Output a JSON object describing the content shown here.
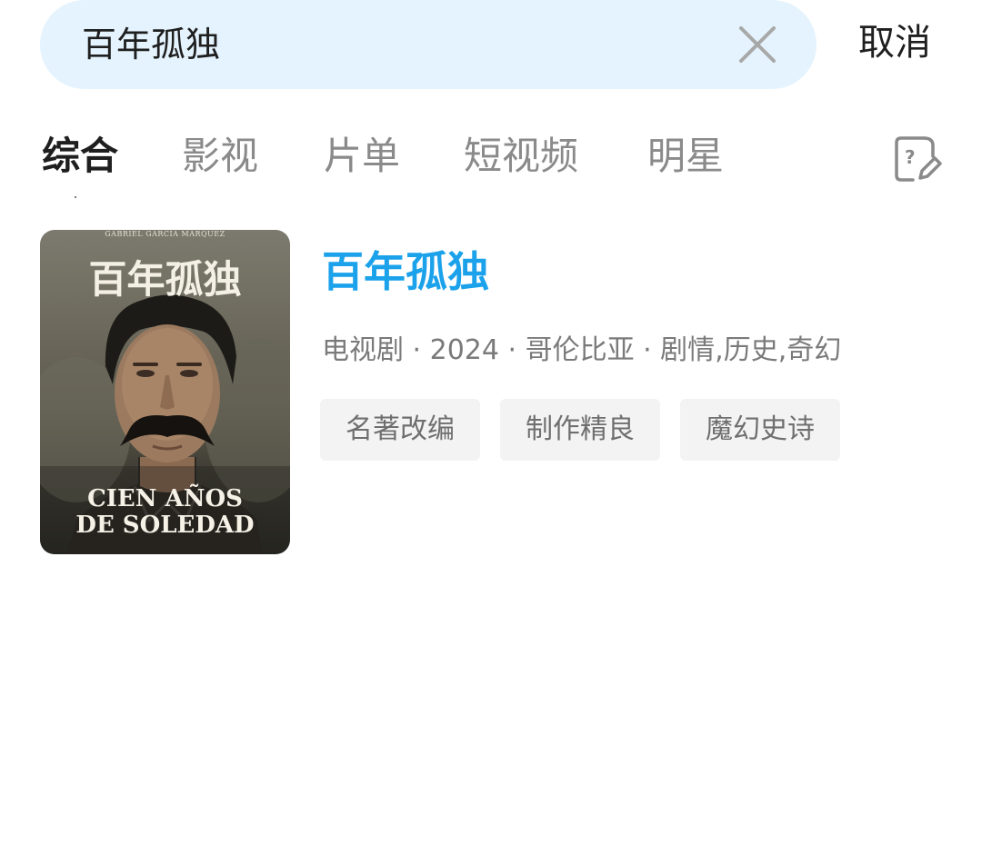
{
  "search": {
    "query": "百年孤独",
    "cancel_label": "取消"
  },
  "tabs": [
    {
      "label": "综合",
      "active": true
    },
    {
      "label": "影视",
      "active": false
    },
    {
      "label": "片单",
      "active": false
    },
    {
      "label": "短视频",
      "active": false
    },
    {
      "label": "明星",
      "active": false
    }
  ],
  "icons": {
    "clear": "close-icon",
    "feedback": "feedback-edit-icon"
  },
  "result": {
    "title": "百年孤独",
    "meta": "电视剧 · 2024 · 哥伦比亚 · 剧情,历史,奇幻",
    "tags": [
      "名著改编",
      "制作精良",
      "魔幻史诗"
    ],
    "poster": {
      "author": "GABRIEL GARCÍA MÁRQUEZ",
      "title_cn": "百年孤独",
      "title_es_line1": "CIEN AÑOS",
      "title_es_line2": "DE SOLEDAD"
    }
  },
  "colors": {
    "search_bg": "#e4f3fd",
    "title_accent": "#1ba2eb",
    "tag_bg": "#f3f3f3"
  }
}
